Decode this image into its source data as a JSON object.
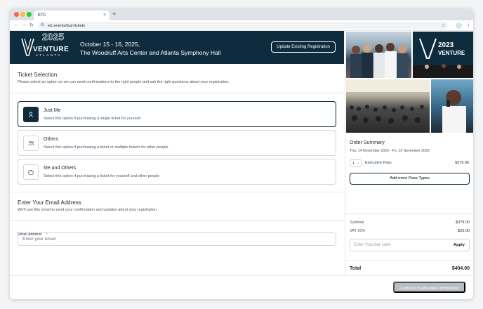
{
  "browser": {
    "tab_title": "ETC",
    "tab_close": "×",
    "new_tab": "+",
    "url": "etc.events/buy-tickets"
  },
  "banner": {
    "logo_text": "VENTURE",
    "logo_year": "2025",
    "logo_sub": "ATLANTA",
    "date_line": "October 15 - 16, 2025,",
    "venue_line": "The Woodruff Arts Center and Atlanta Symphony Hall",
    "update_button": "Update Existing Registration"
  },
  "ticket_selection": {
    "title": "Ticket Selection",
    "subtitle": "Please select an option so we can send confirmations to the right people and ask the right questions about your registration.",
    "options": [
      {
        "label": "Just Me",
        "desc": "Select this option if purchasing a single ticket for yourself",
        "icon": "person-icon",
        "selected": true
      },
      {
        "label": "Others",
        "desc": "Select this option if purchasing a ticket or multiple tickets for other people",
        "icon": "people-icon",
        "selected": false
      },
      {
        "label": "Me and Others",
        "desc": "Select this option if purchasing a ticket for yourself and other people",
        "icon": "briefcase-icon",
        "selected": false
      }
    ]
  },
  "email": {
    "title": "Enter Your Email Address",
    "subtitle": "We'll use this email to send your confirmation and updates about your registration.",
    "field_label": "Email address",
    "required_mark": "*",
    "placeholder": "Enter your email"
  },
  "order": {
    "title": "Order Summary",
    "dates": "Thu, 14 November 2026 - Fri, 15 November 2026",
    "qty": "1",
    "pass_name": "Executive Pass",
    "pass_price": "$379.00",
    "add_button": "Add more Pass Types",
    "subtotal_label": "Subtotal",
    "subtotal_value": "$379.00",
    "vat_label": "VAT 20%",
    "vat_value": "$25.00",
    "voucher_placeholder": "Enter Voucher code",
    "apply_label": "Apply",
    "total_label": "Total",
    "total_value": "$404.00"
  },
  "footer": {
    "continue_button": "Continue to Attendee Information"
  },
  "colors": {
    "brand_navy": "#0e2c3d",
    "disabled_button": "#b9bec5"
  }
}
